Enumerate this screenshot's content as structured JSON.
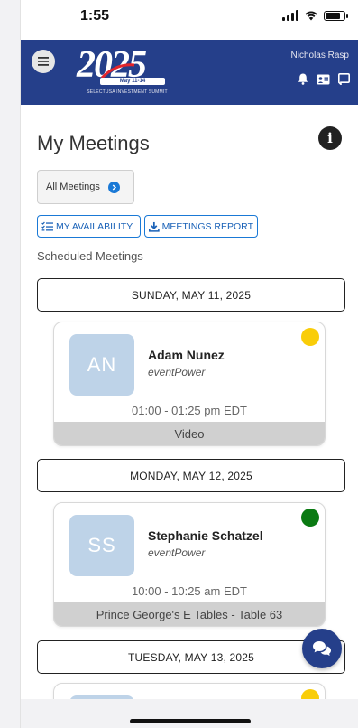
{
  "status_bar": {
    "time": "1:55"
  },
  "header": {
    "logo": {
      "year": "2025",
      "dates": "May 11-14",
      "org": "SELECTUSA INVESTMENT SUMMIT"
    },
    "user_name": "Nicholas Rasp"
  },
  "page": {
    "title": "My Meetings",
    "filter_label": "All Meetings",
    "availability_label": "MY AVAILABILITY",
    "report_label": "MEETINGS REPORT",
    "scheduled_label": "Scheduled Meetings"
  },
  "days": [
    {
      "date": "SUNDAY, MAY 11, 2025",
      "meetings": [
        {
          "initials": "AN",
          "name": "Adam Nunez",
          "company": "eventPower",
          "time": "01:00 - 01:25 pm EDT",
          "location": "Video",
          "status_color": "#f9cd09"
        }
      ]
    },
    {
      "date": "MONDAY, MAY 12, 2025",
      "meetings": [
        {
          "initials": "SS",
          "name": "Stephanie Schatzel",
          "company": "eventPower",
          "time": "10:00 - 10:25 am EDT",
          "location": "Prince George's E Tables - Table 63",
          "status_color": "#0a7a12"
        }
      ]
    },
    {
      "date": "TUESDAY, MAY 13, 2025",
      "meetings": [
        {
          "status_color": "#f9cd09"
        }
      ]
    }
  ],
  "colors": {
    "brand": "#253f8a",
    "accent": "#1a79d6"
  }
}
